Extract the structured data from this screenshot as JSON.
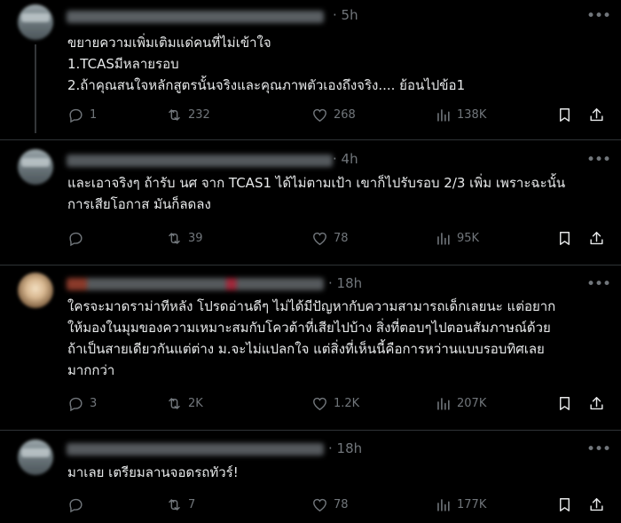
{
  "posts": [
    {
      "time": "· 5h",
      "lines": [
        "ขยายความเพิ่มเติมแด่คนที่ไม่เข้าใจ",
        "1.TCASมีหลายรอบ",
        "2.ถ้าคุณสนใจหลักสูตรนั้นจริงและคุณภาพตัวเองถึงจริง.... ย้อนไปข้อ1"
      ],
      "replies": "1",
      "reposts": "232",
      "likes": "268",
      "views": "138K"
    },
    {
      "time": "· 4h",
      "lines": [
        "และเอาจริงๆ ถ้ารับ นศ จาก TCAS1 ได้ไม่ตามเป้า เขาก็ไปรับรอบ 2/3 เพิ่ม เพราะฉะนั้น",
        "การเสียโอกาส มันก็ลดลง"
      ],
      "replies": "",
      "reposts": "39",
      "likes": "78",
      "views": "95K"
    },
    {
      "time": "· 18h",
      "lines": [
        "ใครจะมาดราม่าทีหลัง โปรดอ่านดีๆ ไม่ได้มีปัญหากับความสามารถเด็กเลยนะ แต่อยาก",
        "ให้มองในมุมของความเหมาะสมกับโควต้าที่เสียไปบ้าง สิ่งที่ตอบๆไปตอนสัมภาษณ์ด้วย",
        "ถ้าเป็นสายเดียวกันแต่ต่าง ม.จะไม่แปลกใจ แต่สิ่งที่เห็นนี้คือการหว่านแบบรอบทิศเลย",
        "มากกว่า"
      ],
      "replies": "3",
      "reposts": "2K",
      "likes": "1.2K",
      "views": "207K"
    },
    {
      "time": "· 18h",
      "lines": [
        "มาเลย เตรียมลานจอดรถทัวร์!"
      ],
      "replies": "",
      "reposts": "7",
      "likes": "78",
      "views": "177K"
    }
  ],
  "colors": {
    "background": "#000000",
    "text": "#e7e9ea",
    "muted": "#71767b",
    "separator": "#2f3336"
  },
  "icons": [
    "reply-icon",
    "repost-icon",
    "like-icon",
    "views-icon",
    "bookmark-icon",
    "share-icon",
    "more-icon"
  ]
}
